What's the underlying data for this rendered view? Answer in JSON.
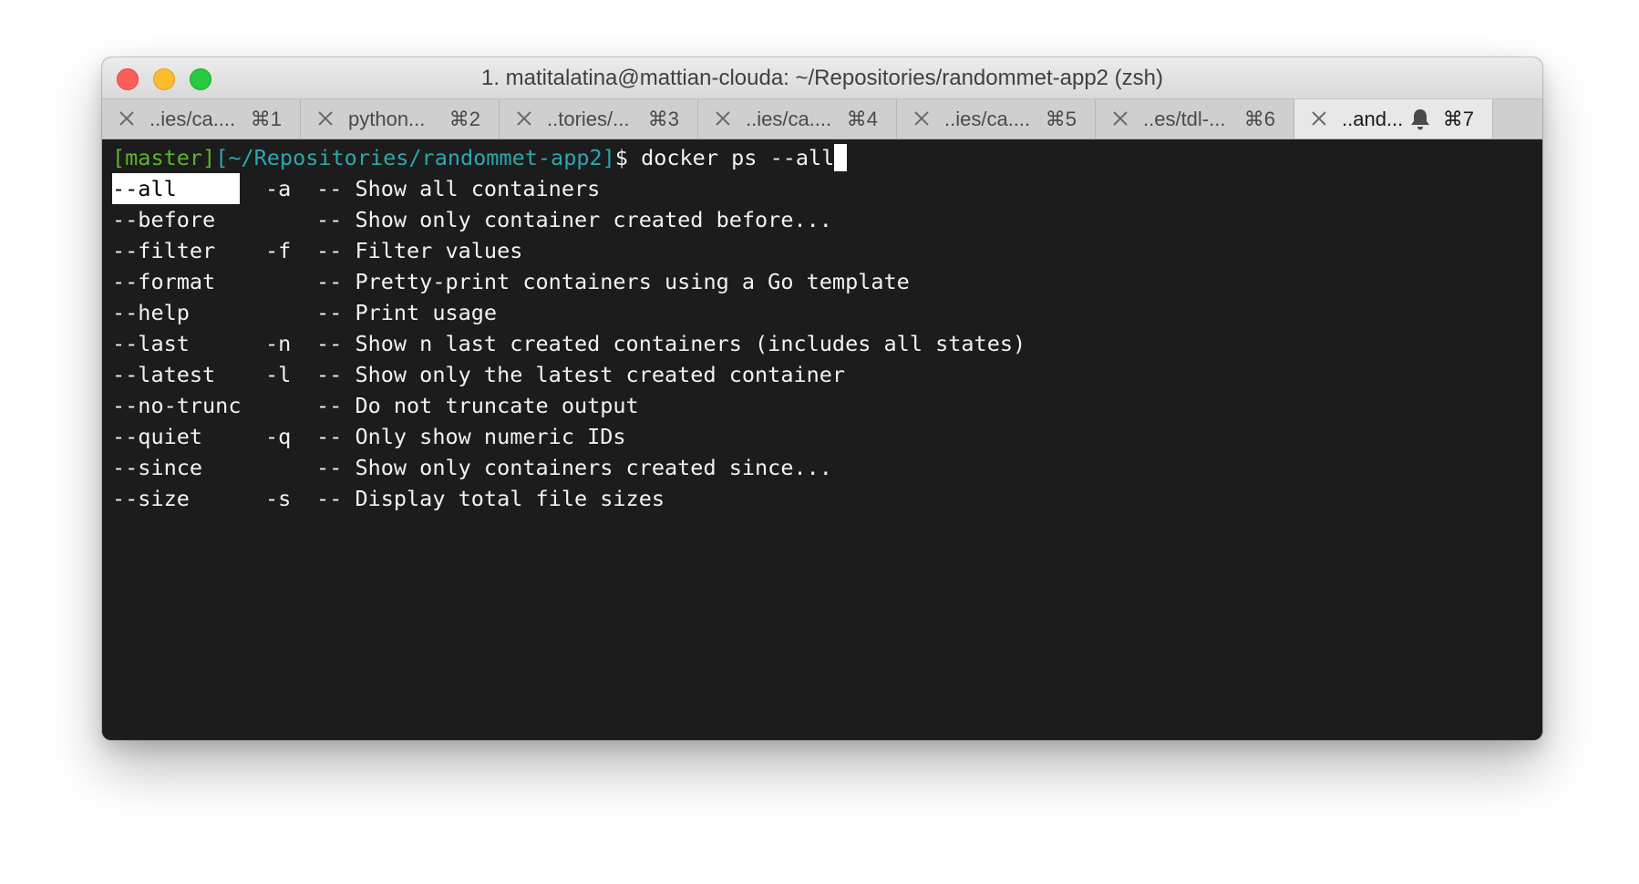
{
  "window": {
    "title": "1. matitalatina@mattian-clouda: ~/Repositories/randommet-app2 (zsh)"
  },
  "tabs": [
    {
      "label": "..ies/ca....",
      "key": "⌘1",
      "active": false
    },
    {
      "label": "python...",
      "key": "⌘2",
      "active": false
    },
    {
      "label": "..tories/...",
      "key": "⌘3",
      "active": false
    },
    {
      "label": "..ies/ca....",
      "key": "⌘4",
      "active": false
    },
    {
      "label": "..ies/ca....",
      "key": "⌘5",
      "active": false
    },
    {
      "label": "..es/tdl-...",
      "key": "⌘6",
      "active": false
    },
    {
      "label": "..and...",
      "key": "⌘7",
      "active": true,
      "icon": "bell-icon"
    }
  ],
  "terminal": {
    "prompt": {
      "branch": "[master]",
      "path": "[~/Repositories/randommet-app2]",
      "symbol": "$ ",
      "command": "docker ps --all"
    },
    "completions": [
      {
        "flag": "--all",
        "short": "-a",
        "desc": "-- Show all containers",
        "selected": true
      },
      {
        "flag": "--before",
        "short": "",
        "desc": "-- Show only container created before...",
        "selected": false
      },
      {
        "flag": "--filter",
        "short": "-f",
        "desc": "-- Filter values",
        "selected": false
      },
      {
        "flag": "--format",
        "short": "",
        "desc": "-- Pretty-print containers using a Go template",
        "selected": false
      },
      {
        "flag": "--help",
        "short": "",
        "desc": "-- Print usage",
        "selected": false
      },
      {
        "flag": "--last",
        "short": "-n",
        "desc": "-- Show n last created containers (includes all states)",
        "selected": false
      },
      {
        "flag": "--latest",
        "short": "-l",
        "desc": "-- Show only the latest created container",
        "selected": false
      },
      {
        "flag": "--no-trunc",
        "short": "",
        "desc": "-- Do not truncate output",
        "selected": false
      },
      {
        "flag": "--quiet",
        "short": "-q",
        "desc": "-- Only show numeric IDs",
        "selected": false
      },
      {
        "flag": "--since",
        "short": "",
        "desc": "-- Show only containers created since...",
        "selected": false
      },
      {
        "flag": "--size",
        "short": "-s",
        "desc": "-- Display total file sizes",
        "selected": false
      }
    ]
  },
  "colors": {
    "terminal_bg": "#1c1c1c",
    "branch": "#5fb32e",
    "path": "#2aa8b0",
    "close": "#fc5f57",
    "minimize": "#fdbc2e",
    "maximize": "#28c840"
  }
}
